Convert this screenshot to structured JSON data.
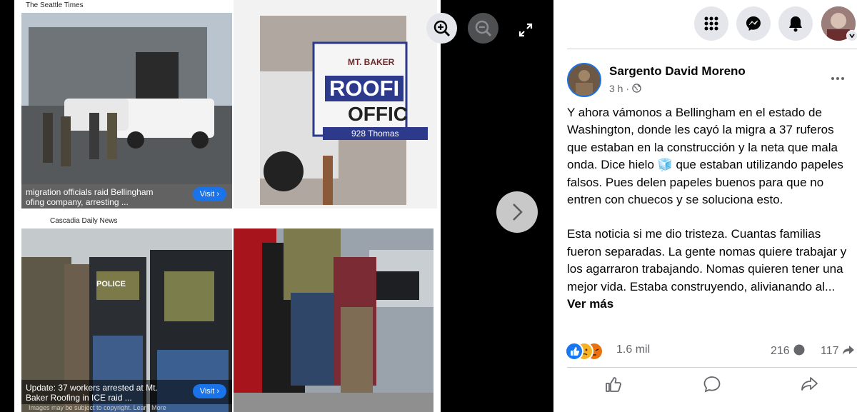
{
  "viewer": {
    "tiles": [
      {
        "source": "The Seattle Times",
        "caption_line1": "migration officials raid Bellingham",
        "caption_line2": "ofing company, arresting ...",
        "visit": "Visit ›"
      },
      {
        "sign_top": "MT. BAKER",
        "sign_main": "ROOFI",
        "sign_sub": "OFFIC",
        "sign_addr": "928 Thomas"
      },
      {
        "source": "Cascadia Daily News",
        "caption_line1": "Update: 37 workers arrested at Mt.",
        "caption_line2": "Baker Roofing in ICE raid ...",
        "visit": "Visit ›",
        "copyright": "Images may be subject to copyright. Learn More",
        "vest_label": "POLICE"
      },
      {}
    ]
  },
  "post": {
    "author": "Sargento David Moreno",
    "time": "3 h",
    "dot": "·",
    "paragraph1": "Y ahora vámonos a Bellingham en el estado de Washington, donde les cayó la migra a 37 ruferos que estaban en la construcción y la neta que mala onda. Dice hielo 🧊 que estaban utilizando papeles falsos. Pues delen papeles buenos para que no entren con chuecos y se soluciona esto.",
    "paragraph2": "Esta noticia si me dio tristeza. Cuantas familias fueron separadas. La gente nomas quiere trabajar y los agarraron trabajando. Nomas quieren tener una mejor vida. Estaba construyendo, alivianando al...",
    "see_more": "Ver más",
    "reactions_count": "1.6 mil",
    "comments_count": "216",
    "shares_count": "117"
  },
  "colors": {
    "accent": "#1b74e4",
    "like": "#1877f2",
    "angry": "#e9710f",
    "sad": "#f7b125"
  }
}
